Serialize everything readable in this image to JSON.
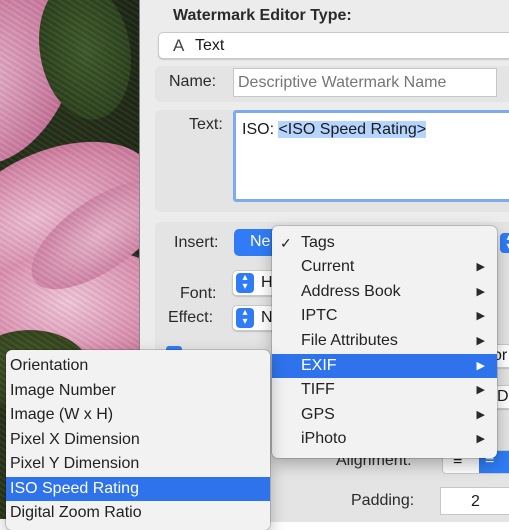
{
  "editor": {
    "type_heading": "Watermark Editor Type:",
    "type_icon": "A",
    "type_value": "Text",
    "name_label": "Name:",
    "name_placeholder": "Descriptive Watermark Name",
    "text_label": "Text:",
    "text_prefix": "ISO: ",
    "text_token": "<ISO Speed Rating>",
    "insert_label": "Insert:",
    "insert_button": "Ne",
    "font_label": "Font:",
    "font_value": "H",
    "effect_label": "Effect:",
    "effect_value": "N",
    "alignment_label": "Alignment:",
    "padding_label": "Padding:",
    "padding_value": "2",
    "clipped_right_1": "or",
    "clipped_right_2": "D"
  },
  "insert_menu": {
    "items": [
      {
        "label": "Tags",
        "checked": true,
        "submenu": false
      },
      {
        "label": "Current",
        "submenu": true
      },
      {
        "label": "Address Book",
        "submenu": true
      },
      {
        "label": "IPTC",
        "submenu": true
      },
      {
        "label": "File Attributes",
        "submenu": true
      },
      {
        "label": "EXIF",
        "submenu": true,
        "selected": true
      },
      {
        "label": "TIFF",
        "submenu": true
      },
      {
        "label": "GPS",
        "submenu": true
      },
      {
        "label": "iPhoto",
        "submenu": true
      }
    ],
    "check_glyph": "✓",
    "arrow_glyph": "▶"
  },
  "exif_submenu": {
    "items": [
      {
        "label": "Orientation"
      },
      {
        "label": "Image Number"
      },
      {
        "label": "Image (W x H)"
      },
      {
        "label": "Pixel X Dimension"
      },
      {
        "label": "Pixel Y Dimension"
      },
      {
        "label": "ISO Speed Rating",
        "selected": true
      },
      {
        "label": "Digital Zoom Ratio"
      }
    ]
  },
  "colors": {
    "accent": "#2e73eb",
    "token_highlight": "#b5d5ff",
    "panel_bg": "#ececec"
  }
}
